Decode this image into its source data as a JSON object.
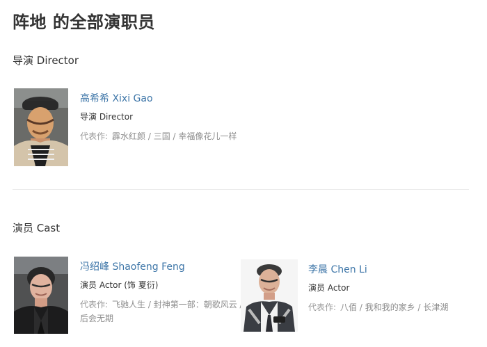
{
  "page": {
    "title": "阵地 的全部演职员"
  },
  "sections": {
    "director": {
      "heading": "导演 Director",
      "people": [
        {
          "name": "高希希 Xixi Gao",
          "role": "导演 Director",
          "works_label": "代表作:",
          "works": "霹水红颜 / 三国 / 幸福像花儿一样"
        }
      ]
    },
    "cast": {
      "heading": "演员 Cast",
      "people": [
        {
          "name": "冯绍峰 Shaofeng Feng",
          "role": "演员 Actor (饰 夏衍)",
          "works_label": "代表作:",
          "works": "飞驰人生 / 封神第一部：朝歌风云 / 后会无期"
        },
        {
          "name": "李晨 Chen Li",
          "role": "演员 Actor",
          "works_label": "代表作:",
          "works": "八佰 / 我和我的家乡 / 长津湖"
        }
      ]
    }
  }
}
